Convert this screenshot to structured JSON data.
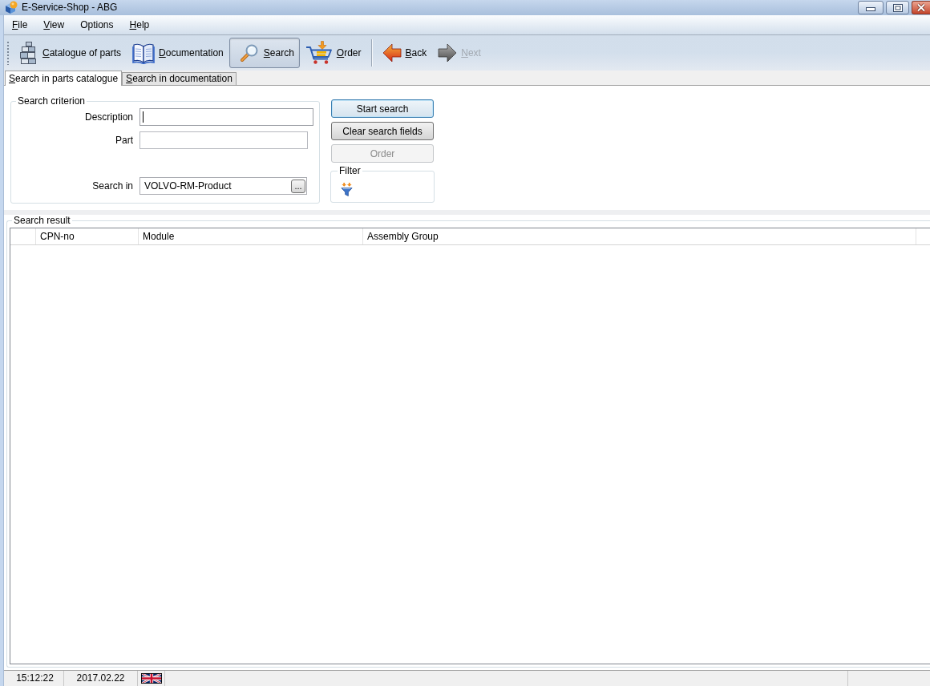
{
  "window": {
    "title": "E-Service-Shop - ABG"
  },
  "menu": [
    {
      "label": "File",
      "underlined_key": true
    },
    {
      "label": "View",
      "underlined_key": true
    },
    {
      "label": "Options",
      "underlined_key": false
    },
    {
      "label": "Help",
      "underlined_key": true
    }
  ],
  "toolbar": [
    {
      "kind": "button",
      "label": "Catalogue of parts",
      "underlined_key": true,
      "selected": false,
      "disabled": false
    },
    {
      "kind": "button",
      "label": "Documentation",
      "underlined_key": true,
      "selected": false,
      "disabled": false
    },
    {
      "kind": "button",
      "label": "Search",
      "underlined_key": true,
      "selected": true,
      "disabled": false
    },
    {
      "kind": "button",
      "label": "Order",
      "underlined_key": true,
      "selected": false,
      "disabled": false
    },
    {
      "kind": "separator"
    },
    {
      "kind": "button",
      "label": "Back",
      "underlined_key": true,
      "selected": false,
      "disabled": false
    },
    {
      "kind": "button",
      "label": "Next",
      "underlined_key": true,
      "selected": false,
      "disabled": true
    }
  ],
  "tabs": [
    {
      "label": "Search in parts catalogue",
      "underlined_key": true,
      "selected": true
    },
    {
      "label": "Search in documentation",
      "underlined_key": true,
      "selected": false
    }
  ],
  "search_criterion": {
    "title": "Search criterion",
    "fields": [
      {
        "kind": "text",
        "label": "Description",
        "focused": true
      },
      {
        "kind": "text",
        "label": "Part",
        "focused": false
      },
      {
        "kind": "picker",
        "label": "Search in",
        "value": "VOLVO-RM-Product",
        "browse_button": "..."
      }
    ]
  },
  "actions": [
    {
      "label": "Start search",
      "focused": true,
      "disabled": false
    },
    {
      "label": "Clear search fields",
      "focused": false,
      "disabled": false
    },
    {
      "label": "Order",
      "focused": false,
      "disabled": true
    }
  ],
  "filter": {
    "title": "Filter"
  },
  "search_result": {
    "title": "Search result",
    "columns": [
      "CPN-no",
      "Module",
      "Assembly Group"
    ]
  },
  "status_bar": {
    "time": "15:12:22",
    "date": "2017.02.22"
  }
}
